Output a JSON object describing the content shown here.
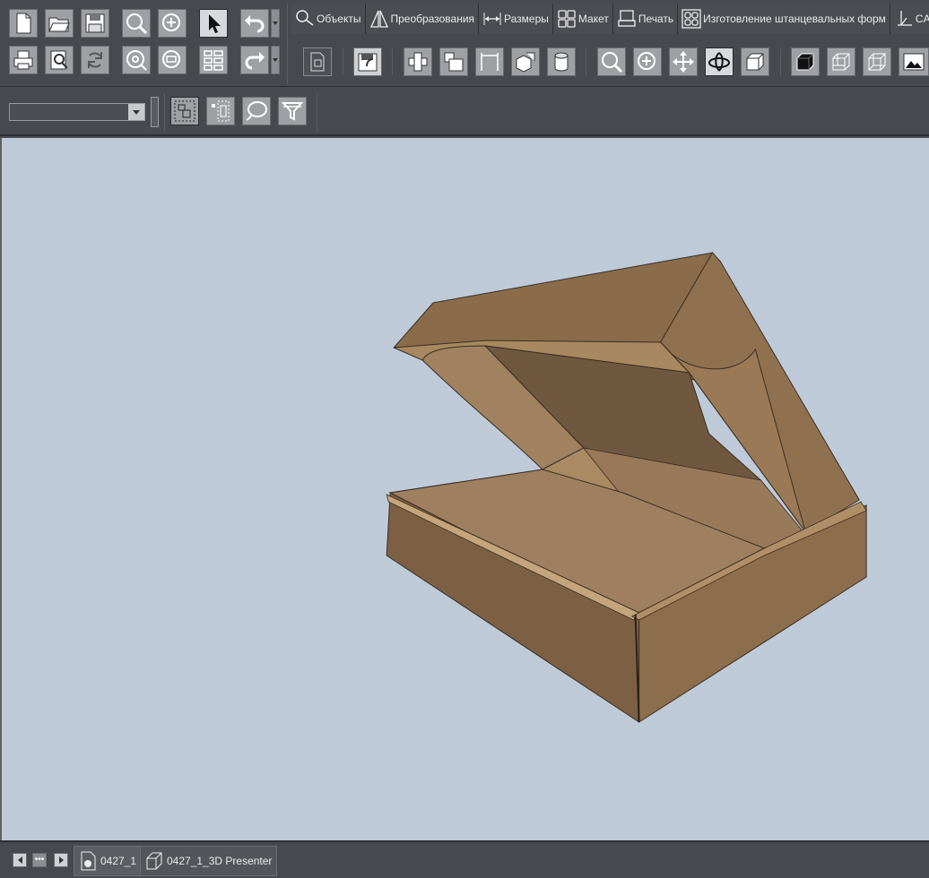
{
  "toolbar": {
    "row1_left": [
      {
        "name": "new-document-icon",
        "title": "New"
      },
      {
        "name": "open-folder-icon",
        "title": "Open"
      },
      {
        "name": "save-icon",
        "title": "Save"
      },
      {
        "name": "zoom-icon",
        "title": "Zoom"
      },
      {
        "name": "zoom-in-icon",
        "title": "Zoom in"
      },
      {
        "name": "select-pointer-icon",
        "title": "Select"
      },
      {
        "name": "undo-icon",
        "title": "Undo"
      }
    ],
    "row2_left": [
      {
        "name": "print-icon",
        "title": "Print"
      },
      {
        "name": "print-preview-icon",
        "title": "Print preview"
      },
      {
        "name": "refresh-icon",
        "title": "Refresh"
      },
      {
        "name": "zoom-fit-icon",
        "title": "Zoom fit"
      },
      {
        "name": "zoom-out-icon",
        "title": "Zoom out"
      },
      {
        "name": "layers-grid-icon",
        "title": "Layers"
      },
      {
        "name": "redo-icon",
        "title": "Redo"
      }
    ]
  },
  "ribbon": {
    "tabs": [
      {
        "label": "Объекты",
        "icon": "objects-icon"
      },
      {
        "label": "Преобразования",
        "icon": "transform-icon"
      },
      {
        "label": "Размеры",
        "icon": "dimensions-icon"
      },
      {
        "label": "Макет",
        "icon": "layout-icon"
      },
      {
        "label": "Печать",
        "icon": "print-tab-icon"
      },
      {
        "label": "Изготовление штанцевальных форм",
        "icon": "die-making-icon"
      },
      {
        "label": "CAM",
        "icon": "cam-icon"
      }
    ],
    "tools": [
      "export-document-icon",
      "save-as-icon",
      "fold-box-icon",
      "layout-box-icon",
      "dimension-box-icon",
      "cube-transform-icon",
      "cylinder-icon",
      "view-zoom-icon",
      "view-zoom-in-icon",
      "pan-move-icon",
      "orbit-rotate-icon",
      "cube-outline-icon",
      "solid-cube-icon",
      "ghost-cube-icon",
      "wireframe-cube-icon",
      "render-image-icon"
    ]
  },
  "second_toolbar": {
    "combo_value": "",
    "tools": [
      "select-layers-icon",
      "select-dashed-icon",
      "lasso-icon",
      "filter-icon"
    ]
  },
  "viewport": {
    "background": "#becad8",
    "object": "open cardboard mailer box (3D view)"
  },
  "tabbar": {
    "tabs": [
      {
        "label": "0427_1",
        "icon": "document-2d-icon",
        "active": true
      },
      {
        "label": "0427_1_3D Presenter",
        "icon": "document-3d-icon",
        "active": false
      }
    ],
    "more_label": "•••"
  }
}
